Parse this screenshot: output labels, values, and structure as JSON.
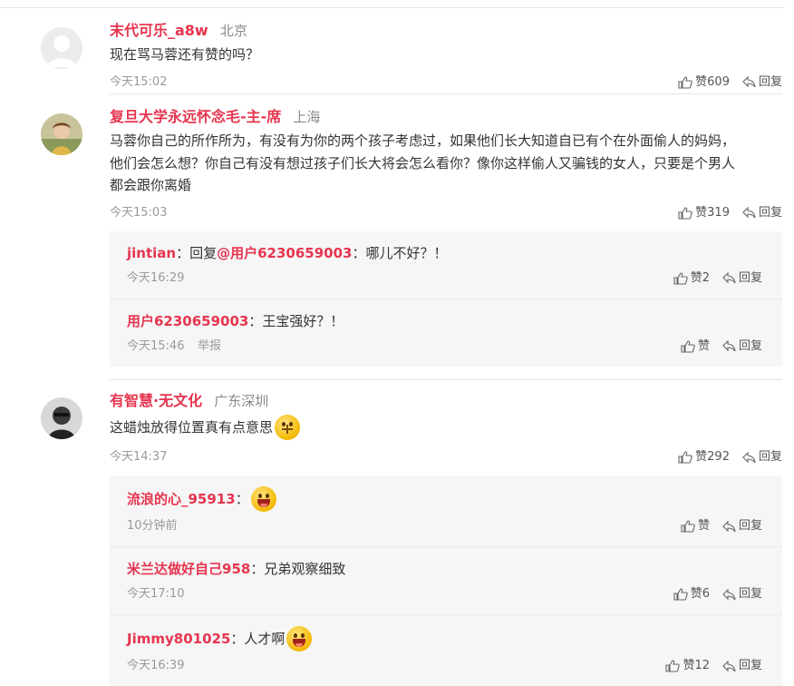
{
  "colors": {
    "username": "#e6354f",
    "meta": "#9a9a9a",
    "reply_bg": "#f6f6f6"
  },
  "icons": {
    "like": "thumbs-up-icon",
    "reply": "reply-arrow-icon"
  },
  "comments": [
    {
      "username": "末代可乐_a8w",
      "location": "北京",
      "text": "现在骂马蓉还有赞的吗？",
      "time": "今天15:02",
      "like_label": "赞609",
      "reply_label": "回复",
      "replies": []
    },
    {
      "username": "复旦大学永远怀念毛-主-席",
      "location": "上海",
      "text": "马蓉你自己的所作所为，有没有为你的两个孩子考虑过，如果他们长大知道自已有个在外面偷人的妈妈，\n他们会怎么想？你自己有没有想过孩子们长大将会怎么看你？像你这样偷人又骗钱的女人，只要是个男人\n都会跟你离婚",
      "time": "今天15:03",
      "like_label": "赞319",
      "reply_label": "回复",
      "replies": [
        {
          "username": "jintian",
          "prefix": "：回复",
          "mention": "@用户6230659003",
          "sep": "：",
          "text": "哪儿不好？！",
          "time": "今天16:29",
          "like_label": "赞2",
          "reply_label": "回复"
        },
        {
          "username": "用户6230659003",
          "sep": "：",
          "text": "王宝强好？！",
          "time": "今天15:46",
          "report_label": "举报",
          "like_label": "赞",
          "reply_label": "回复"
        }
      ]
    },
    {
      "username": "有智慧·无文化",
      "location": "广东深圳",
      "text": "这蜡烛放得位置真有点意思",
      "time": "今天14:37",
      "like_label": "赞292",
      "reply_label": "回复",
      "replies": [
        {
          "username": "流浪的心_95913",
          "sep": "：",
          "text": "",
          "time": "10分钟前",
          "like_label": "赞",
          "reply_label": "回复"
        },
        {
          "username": "米兰达做好自己958",
          "sep": "：",
          "text": "兄弟观察细致",
          "time": "今天17:10",
          "like_label": "赞6",
          "reply_label": "回复"
        },
        {
          "username": "Jimmy801025",
          "sep": "：",
          "text": "人才啊",
          "time": "今天16:39",
          "like_label": "赞12",
          "reply_label": "回复"
        }
      ]
    }
  ]
}
